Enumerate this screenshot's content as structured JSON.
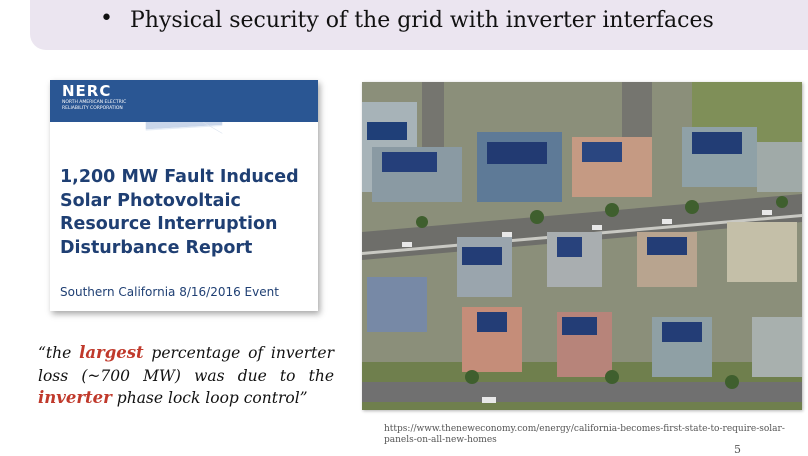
{
  "bullet": {
    "marker": "•",
    "text": "Physical security of the grid with inverter interfaces"
  },
  "report": {
    "logo": "NERC",
    "logo_sub": "NORTH AMERICAN ELECTRIC RELIABILITY CORPORATION",
    "title": "1,200 MW Fault Induced Solar Photovoltaic Resource Interruption Disturbance Report",
    "subtitle": "Southern California 8/16/2016 Event"
  },
  "quote": {
    "part1": "“the ",
    "hl1": "largest",
    "part2": " percentage of inverter loss (~700 MW) was due to the ",
    "hl2": "inverter",
    "part3": " phase lock loop control”"
  },
  "source": "https://www.theneweconomy.com/energy/california-becomes-first-state-to-require-solar-panels-on-all-new-homes",
  "page_number": "5",
  "colors": {
    "accent_red": "#c0392b",
    "nerc_blue": "#2a5693",
    "bullet_bg": "#ebe5f0"
  }
}
